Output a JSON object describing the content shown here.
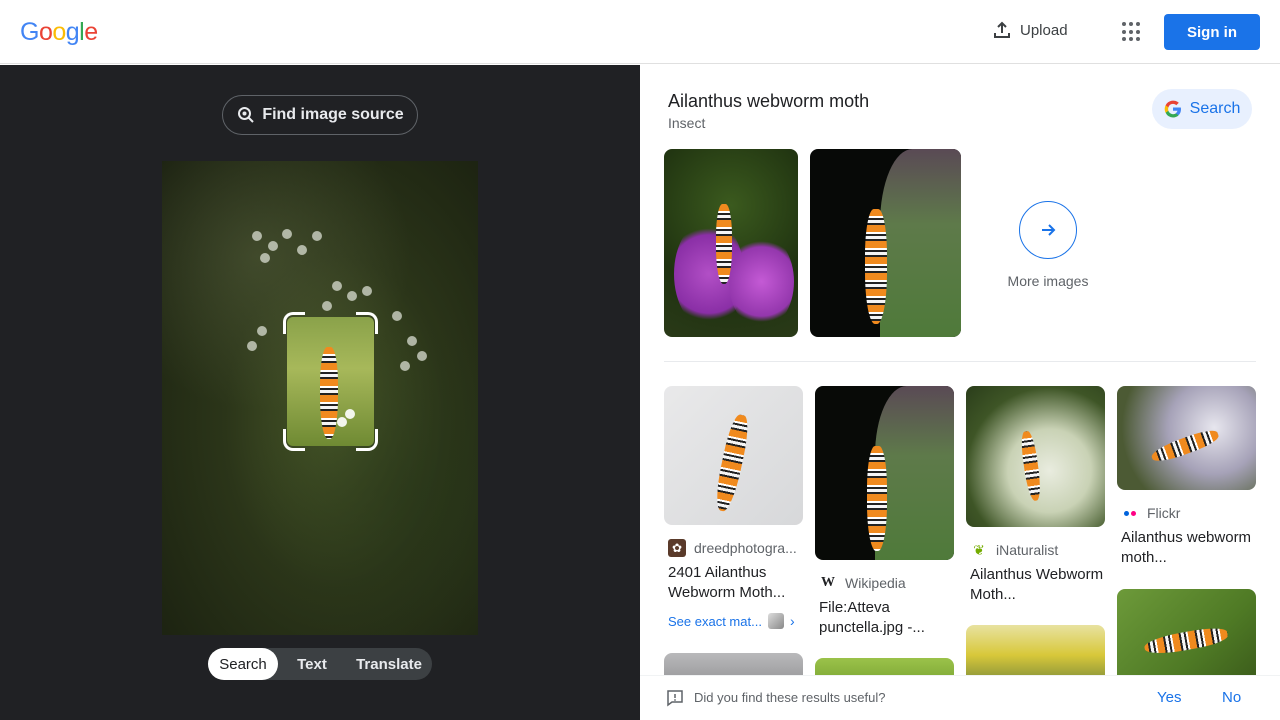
{
  "header": {
    "logo": [
      "G",
      "o",
      "o",
      "g",
      "l",
      "e"
    ],
    "logo_colors": [
      "#4285f4",
      "#ea4335",
      "#fbbc05",
      "#4285f4",
      "#34a853",
      "#ea4335"
    ],
    "upload_label": "Upload",
    "signin_label": "Sign in"
  },
  "left": {
    "find_source_label": "Find image source",
    "modes": [
      "Search",
      "Text",
      "Translate"
    ],
    "active_mode": "Search"
  },
  "knowledge": {
    "title": "Ailanthus webworm moth",
    "subtitle": "Insect",
    "search_label": "Search",
    "more_images_label": "More images"
  },
  "results": [
    {
      "source": "dreedphotogra...",
      "title": "2401 Ailanthus Webworm Moth...",
      "favicon": "photo-favicon",
      "extra": "See exact mat..."
    },
    {
      "source": "Wikipedia",
      "title": "File:Atteva punctella.jpg -...",
      "favicon": "wikipedia-favicon"
    },
    {
      "source": "iNaturalist",
      "title": "Ailanthus Webworm Moth...",
      "favicon": "inaturalist-favicon"
    },
    {
      "source": "Flickr",
      "title": "Ailanthus webworm moth...",
      "favicon": "flickr-favicon"
    }
  ],
  "feedback": {
    "question": "Did you find these results useful?",
    "yes": "Yes",
    "no": "No"
  },
  "colors": {
    "accent": "#1a73e8",
    "dark_pane": "#202124"
  }
}
